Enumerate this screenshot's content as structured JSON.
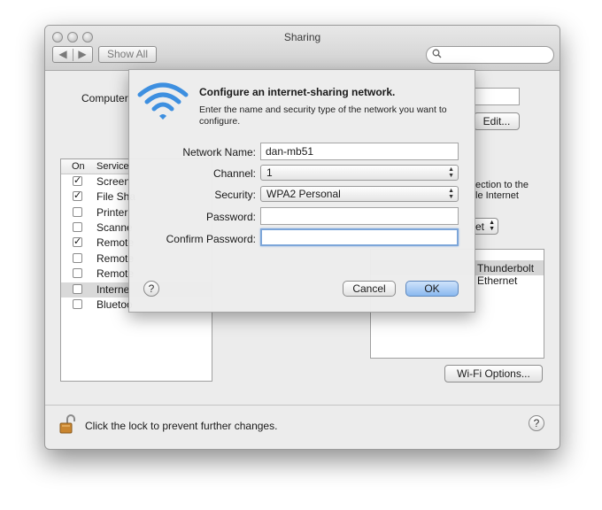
{
  "window": {
    "title": "Sharing"
  },
  "toolbar": {
    "back_glyph": "◀",
    "forward_glyph": "▶",
    "show_all": "Show All",
    "search_icon": "magnifier-icon"
  },
  "background": {
    "computer_label": "Computer",
    "edit_button": "Edit...",
    "right_frag_1": "ection to the",
    "right_frag_2": "le Internet",
    "popup_frag": "et",
    "list_item": "Thunderbolt Ethernet",
    "wifi_options": "Wi-Fi Options..."
  },
  "services": {
    "col_on": "On",
    "col_service": "Service",
    "items": [
      {
        "name": "Screen",
        "checked": "✓"
      },
      {
        "name": "File Sha",
        "checked": "✓"
      },
      {
        "name": "Printer",
        "checked": ""
      },
      {
        "name": "Scanne",
        "checked": ""
      },
      {
        "name": "Remote",
        "checked": "✓"
      },
      {
        "name": "Remote",
        "checked": ""
      },
      {
        "name": "Remote",
        "checked": ""
      },
      {
        "name": "Interne",
        "checked": ""
      },
      {
        "name": "Bluetoo",
        "checked": ""
      }
    ]
  },
  "footer": {
    "lock_text": "Click the lock to prevent further changes.",
    "help": "?"
  },
  "sheet": {
    "title": "Configure an internet-sharing network.",
    "description": "Enter the name and security type of the network you want to configure.",
    "network_name_label": "Network Name:",
    "network_name_value": "dan-mb51",
    "channel_label": "Channel:",
    "channel_value": "1",
    "security_label": "Security:",
    "security_value": "WPA2 Personal",
    "password_label": "Password:",
    "confirm_label": "Confirm Password:",
    "help": "?",
    "cancel": "Cancel",
    "ok": "OK"
  },
  "colors": {
    "default_button": "#8ab8ef",
    "wifi_blue": "#3d8fe0",
    "focus_ring": "#7da6d9"
  }
}
